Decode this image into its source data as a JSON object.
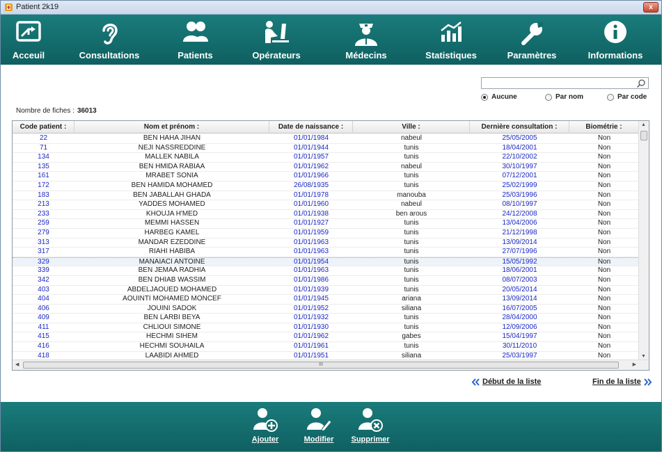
{
  "window": {
    "title": "Patient 2k19",
    "close_label": "x"
  },
  "nav": [
    {
      "label": "Acceuil",
      "icon": "home-screen-icon"
    },
    {
      "label": "Consultations",
      "icon": "ear-icon"
    },
    {
      "label": "Patients",
      "icon": "users-icon"
    },
    {
      "label": "Opérateurs",
      "icon": "operator-desk-icon"
    },
    {
      "label": "Médecins",
      "icon": "doctor-icon"
    },
    {
      "label": "Statistiques",
      "icon": "bar-chart-icon"
    },
    {
      "label": "Paramètres",
      "icon": "wrench-icon"
    },
    {
      "label": "Informations",
      "icon": "info-icon"
    }
  ],
  "search": {
    "value": "",
    "placeholder": ""
  },
  "filter": {
    "options": [
      "Aucune",
      "Par nom",
      "Par code"
    ],
    "selected": "Aucune"
  },
  "count": {
    "label": "Nombre de fiches :",
    "value": "36013"
  },
  "table": {
    "headers": [
      "Code patient :",
      "Nom et prénom :",
      "Date de naissance :",
      "Ville :",
      "Dernière consultation :",
      "Biométrie :"
    ],
    "rows": [
      [
        "22",
        "BEN HAHA JIHAN",
        "01/01/1984",
        "nabeul",
        "25/05/2005",
        "Non"
      ],
      [
        "71",
        "NEJI NASSREDDINE",
        "01/01/1944",
        "tunis",
        "18/04/2001",
        "Non"
      ],
      [
        "134",
        "MALLEK NABILA",
        "01/01/1957",
        "tunis",
        "22/10/2002",
        "Non"
      ],
      [
        "135",
        "BEN HMIDA RABIAA",
        "01/01/1962",
        "nabeul",
        "30/10/1997",
        "Non"
      ],
      [
        "161",
        "MRABET SONIA",
        "01/01/1966",
        "tunis",
        "07/12/2001",
        "Non"
      ],
      [
        "172",
        "BEN HAMIDA MOHAMED",
        "26/08/1935",
        "tunis",
        "25/02/1999",
        "Non"
      ],
      [
        "183",
        "BEN JABALLAH GHADA",
        "01/01/1978",
        "manouba",
        "25/03/1996",
        "Non"
      ],
      [
        "213",
        "YADDES MOHAMED",
        "01/01/1960",
        "nabeul",
        "08/10/1997",
        "Non"
      ],
      [
        "233",
        "KHOUJA H'MED",
        "01/01/1938",
        "ben arous",
        "24/12/2008",
        "Non"
      ],
      [
        "259",
        "MEMMI HASSEN",
        "01/01/1927",
        "tunis",
        "13/04/2006",
        "Non"
      ],
      [
        "279",
        "HARBEG KAMEL",
        "01/01/1959",
        "tunis",
        "21/12/1998",
        "Non"
      ],
      [
        "313",
        "MANDAR EZEDDINE",
        "01/01/1963",
        "tunis",
        "13/09/2014",
        "Non"
      ],
      [
        "317",
        "RIAHI HABIBA",
        "01/01/1963",
        "tunis",
        "27/07/1996",
        "Non"
      ],
      [
        "329",
        "MANAIACI ANTOINE",
        "01/01/1954",
        "tunis",
        "15/05/1992",
        "Non"
      ],
      [
        "339",
        "BEN JEMAA RADHIA",
        "01/01/1963",
        "tunis",
        "18/06/2001",
        "Non"
      ],
      [
        "342",
        "BEN DHIAB WASSIM",
        "01/01/1986",
        "tunis",
        "08/07/2003",
        "Non"
      ],
      [
        "403",
        "ABDELJAOUED MOHAMED",
        "01/01/1939",
        "tunis",
        "20/05/2014",
        "Non"
      ],
      [
        "404",
        "AOUINTI  MOHAMED MONCEF",
        "01/01/1945",
        "ariana",
        "13/09/2014",
        "Non"
      ],
      [
        "406",
        "JOUINI SADOK",
        "01/01/1952",
        "siliana",
        "16/07/2005",
        "Non"
      ],
      [
        "409",
        "BEN LARBI BEYA",
        "01/01/1932",
        "tunis",
        "28/04/2000",
        "Non"
      ],
      [
        "411",
        "CHLIOUI SIMONE",
        "01/01/1930",
        "tunis",
        "12/09/2006",
        "Non"
      ],
      [
        "415",
        "HECHMI SIHEM",
        "01/01/1962",
        "gabes",
        "15/04/1997",
        "Non"
      ],
      [
        "416",
        "HECHMI SOUHAILA",
        "01/01/1961",
        "tunis",
        "30/11/2010",
        "Non"
      ],
      [
        "418",
        "LAABIDI AHMED",
        "01/01/1951",
        "siliana",
        "25/03/1997",
        "Non"
      ]
    ],
    "selected_row": 13,
    "hscroll_grip": "III"
  },
  "pager": {
    "first": "Début de la liste",
    "last": "Fin de la liste"
  },
  "actions": [
    {
      "label": "Ajouter",
      "icon": "user-add-icon"
    },
    {
      "label": "Modifier",
      "icon": "user-edit-icon"
    },
    {
      "label": "Supprimer",
      "icon": "user-delete-icon"
    }
  ],
  "colors": {
    "nav_bg": "#136d6d",
    "link_blue": "#1a27c4",
    "accent_arrow": "#2a64c8"
  }
}
